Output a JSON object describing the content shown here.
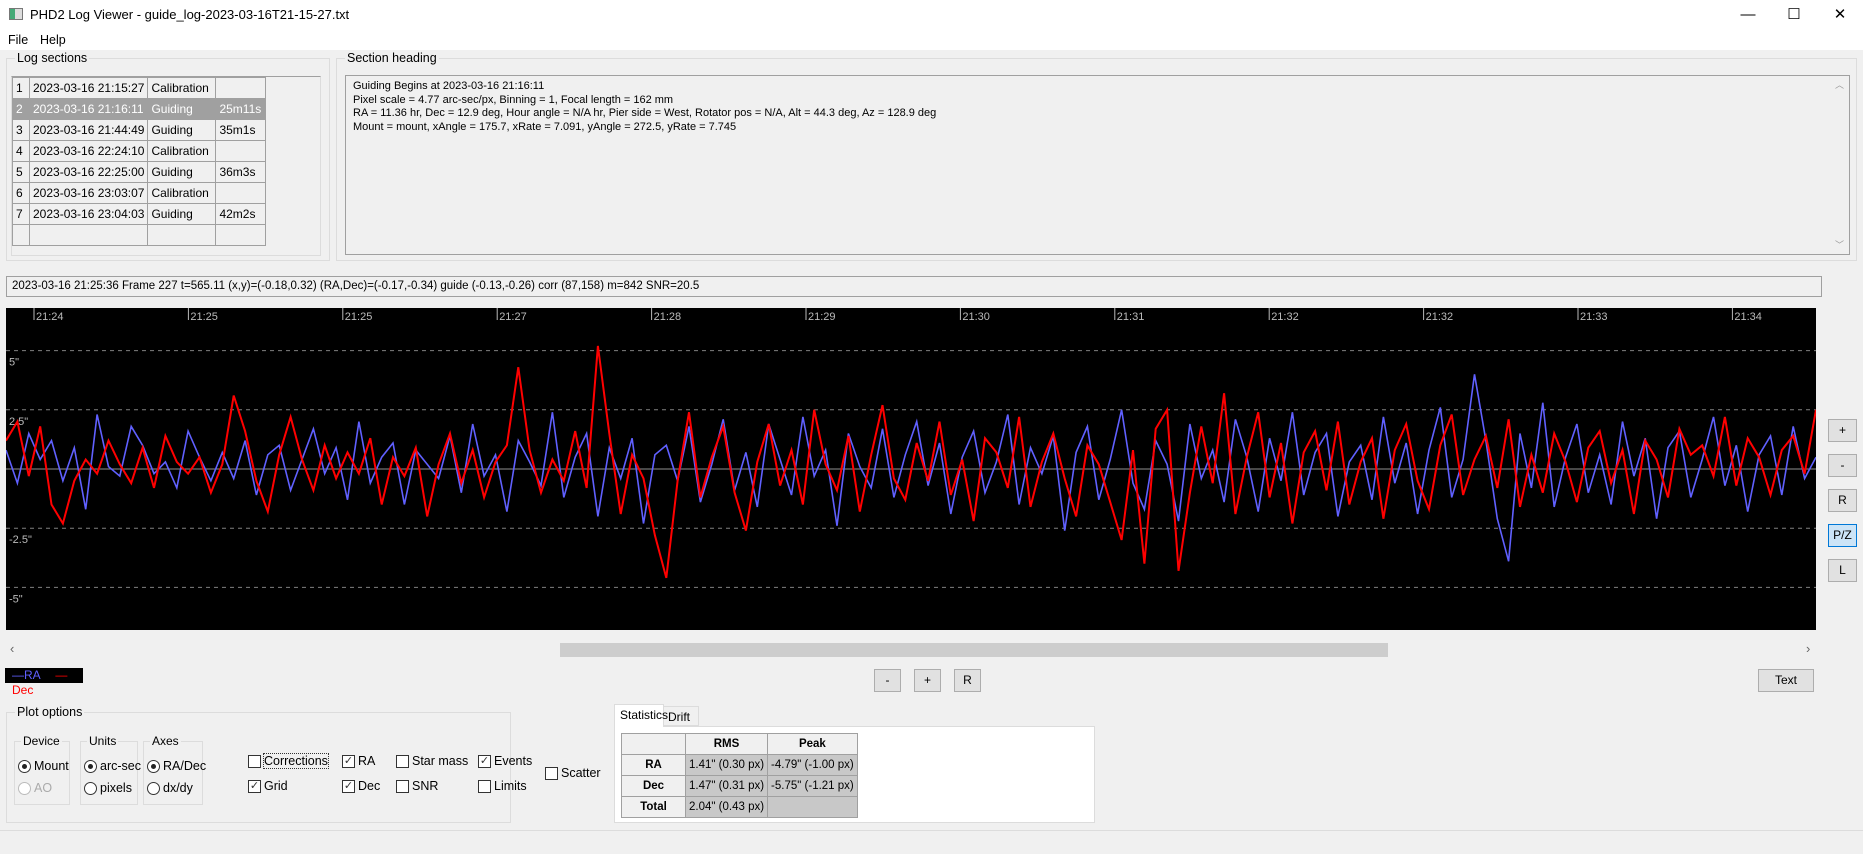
{
  "window": {
    "title": "PHD2 Log Viewer - guide_log-2023-03-16T21-15-27.txt",
    "minimize": "—",
    "maximize": "☐",
    "close": "✕"
  },
  "menu": [
    {
      "label": "File"
    },
    {
      "label": "Help"
    }
  ],
  "log_sections": {
    "label": "Log sections",
    "rows": [
      {
        "n": "1",
        "time": "2023-03-16 21:15:27",
        "type": "Calibration",
        "dur": ""
      },
      {
        "n": "2",
        "time": "2023-03-16 21:16:11",
        "type": "Guiding",
        "dur": "25m11s",
        "selected": true
      },
      {
        "n": "3",
        "time": "2023-03-16 21:44:49",
        "type": "Guiding",
        "dur": "35m1s"
      },
      {
        "n": "4",
        "time": "2023-03-16 22:24:10",
        "type": "Calibration",
        "dur": ""
      },
      {
        "n": "5",
        "time": "2023-03-16 22:25:00",
        "type": "Guiding",
        "dur": "36m3s"
      },
      {
        "n": "6",
        "time": "2023-03-16 23:03:07",
        "type": "Calibration",
        "dur": ""
      },
      {
        "n": "7",
        "time": "2023-03-16 23:04:03",
        "type": "Guiding",
        "dur": "42m2s"
      },
      {
        "n": "",
        "time": "",
        "type": "",
        "dur": ""
      }
    ]
  },
  "section_heading": {
    "label": "Section heading",
    "lines": [
      "Guiding Begins at 2023-03-16 21:16:11",
      "Pixel scale = 4.77 arc-sec/px, Binning = 1, Focal length = 162 mm",
      "RA = 11.36 hr, Dec = 12.9 deg, Hour angle = N/A hr, Pier side = West, Rotator pos = N/A, Alt = 44.3 deg, Az = 128.9 deg",
      "Mount = mount, xAngle = 175.7, xRate = 7.091, yAngle = 272.5, yRate = 7.745"
    ]
  },
  "status_line": "2023-03-16 21:25:36 Frame 227 t=565.11 (x,y)=(-0.18,0.32) (RA,Dec)=(-0.17,-0.34) guide (-0.13,-0.26) corr (87,158) m=842 SNR=20.5",
  "chart_data": {
    "type": "line",
    "grid": true,
    "ylim": [
      -6.8,
      6.8
    ],
    "x_ticks": [
      "21:24",
      "21:25",
      "21:25",
      "21:27",
      "21:28",
      "21:29",
      "21:30",
      "21:31",
      "21:32",
      "21:32",
      "21:33",
      "21:34"
    ],
    "y_ticks": [
      {
        "v": 5,
        "label": "5\""
      },
      {
        "v": 2.5,
        "label": "2.5\""
      },
      {
        "v": 0,
        "label": ""
      },
      {
        "v": -2.5,
        "label": "-2.5\""
      },
      {
        "v": -5,
        "label": "-5\""
      }
    ],
    "series": [
      {
        "name": "RA",
        "color": "#6060ff",
        "values": [
          0.8,
          -0.6,
          1.5,
          0.4,
          1.2,
          -0.5,
          0.9,
          -1.7,
          2.3,
          0.1,
          -0.3,
          1.8,
          1.0,
          -0.2,
          0.3,
          -0.8,
          1.6,
          0.5,
          -0.5,
          0.7,
          -0.4,
          1.2,
          -1.1,
          0.6,
          1.0,
          -0.9,
          0.4,
          1.7,
          -0.2,
          0.9,
          -1.3,
          2.0,
          -0.6,
          0.5,
          1.1,
          -1.5,
          0.8,
          0.2,
          -0.4,
          1.4,
          -1.0,
          1.9,
          -0.3,
          0.6,
          -1.8,
          1.2,
          0.3,
          -0.7,
          2.4,
          -1.2,
          0.5,
          1.5,
          -2.0,
          0.9,
          -0.4,
          1.3,
          -2.3,
          0.6,
          1.0,
          -0.5,
          1.8,
          -1.4,
          0.2,
          2.1,
          -0.9,
          0.7,
          -1.6,
          1.9,
          0.4,
          -1.1,
          2.2,
          -0.3,
          0.8,
          -2.4,
          1.5,
          0.1,
          -0.8,
          1.7,
          -1.2,
          0.6,
          2.0,
          -0.7,
          1.1,
          -1.9,
          0.5,
          1.6,
          -1.0,
          0.3,
          2.3,
          -1.5,
          0.9,
          -0.2,
          1.4,
          -2.6,
          0.7,
          1.8,
          -1.3,
          0.4,
          2.5,
          -0.6,
          -1.7,
          1.2,
          0.2,
          -2.2,
          1.9,
          -0.4,
          0.8,
          -1.4,
          2.1,
          0.5,
          -1.8,
          1.3,
          -0.5,
          2.4,
          -1.1,
          0.7,
          1.5,
          -2.0,
          0.3,
          1.0,
          -1.3,
          2.2,
          -0.6,
          1.1,
          -1.9,
          0.8,
          2.6,
          -1.2,
          0.4,
          4.0,
          1.2,
          -2.1,
          -3.9,
          1.5,
          -0.8,
          2.8,
          -1.6,
          0.5,
          1.9,
          -1.0,
          0.6,
          -1.5,
          2.0,
          -0.3,
          1.3,
          -2.1,
          0.9,
          1.6,
          -1.2,
          0.4,
          2.2,
          -0.7,
          1.0,
          -1.8,
          0.6,
          1.4,
          -1.1,
          1.8,
          -0.4,
          0.5
        ]
      },
      {
        "name": "Dec",
        "color": "#ff0000",
        "values": [
          1.2,
          2.0,
          -0.3,
          1.8,
          -1.5,
          -2.3,
          -0.5,
          0.4,
          -0.2,
          1.2,
          0.2,
          -0.6,
          0.9,
          -0.8,
          1.4,
          0.3,
          -0.2,
          0.5,
          -1.0,
          0.2,
          3.1,
          1.6,
          -0.5,
          -1.8,
          0.6,
          2.2,
          0.4,
          -0.9,
          1.0,
          -0.4,
          0.7,
          -0.2,
          1.3,
          -1.5,
          0.5,
          -0.3,
          0.9,
          -2.0,
          0.2,
          1.5,
          -0.6,
          0.8,
          -1.2,
          0.3,
          1.0,
          4.3,
          0.8,
          -1.0,
          0.4,
          -0.5,
          1.6,
          -0.8,
          5.2,
          1.5,
          -1.9,
          0.6,
          -0.4,
          -2.8,
          -4.6,
          -0.5,
          2.4,
          -1.2,
          0.5,
          1.8,
          -1.0,
          -2.6,
          0.3,
          1.9,
          -0.7,
          0.8,
          -1.5,
          2.5,
          0.2,
          -0.9,
          1.4,
          -1.8,
          0.6,
          2.7,
          -0.4,
          -1.3,
          1.1,
          -0.5,
          2.0,
          -1.1,
          0.4,
          -2.2,
          1.3,
          0.7,
          -0.8,
          2.2,
          -1.6,
          0.3,
          1.5,
          -0.4,
          -2.0,
          1.0,
          0.2,
          -1.4,
          -3.0,
          0.8,
          -4.0,
          1.7,
          2.5,
          -4.3,
          -1.0,
          1.8,
          -0.6,
          3.2,
          -1.9,
          0.5,
          2.4,
          -1.2,
          1.1,
          -2.3,
          0.7,
          1.6,
          -0.9,
          2.0,
          -1.5,
          0.3,
          1.3,
          -2.1,
          0.8,
          1.9,
          -0.5,
          -1.7,
          1.0,
          2.3,
          -1.1,
          0.4,
          1.4,
          -0.8,
          2.1,
          -1.6,
          0.6,
          -1.0,
          1.5,
          0.3,
          -1.4,
          0.9,
          1.6,
          -0.6,
          0.8,
          -1.9,
          1.2,
          0.4,
          -1.2,
          1.7,
          0.6,
          1.0,
          -0.3,
          2.2,
          -0.7,
          1.3,
          0.5,
          -1.1,
          0.8,
          1.4,
          -0.2,
          2.5
        ]
      }
    ]
  },
  "side_buttons": [
    "+",
    "-",
    "R",
    "P/Z",
    "L"
  ],
  "legend": {
    "ra": "—RA",
    "dec": "—Dec"
  },
  "zoom_buttons": [
    "-",
    "+",
    "R"
  ],
  "text_button": "Text",
  "plot_options": {
    "label": "Plot options",
    "device": {
      "label": "Device",
      "options": [
        {
          "label": "Mount",
          "on": true
        },
        {
          "label": "AO",
          "disabled": true
        }
      ]
    },
    "units": {
      "label": "Units",
      "options": [
        {
          "label": "arc-sec",
          "on": true
        },
        {
          "label": "pixels"
        }
      ]
    },
    "axes": {
      "label": "Axes",
      "options": [
        {
          "label": "RA/Dec",
          "on": true
        },
        {
          "label": "dx/dy"
        }
      ]
    },
    "checks": {
      "corrections": {
        "label": "Corrections",
        "on": false
      },
      "grid": {
        "label": "Grid",
        "on": true
      },
      "ra": {
        "label": "RA",
        "on": true
      },
      "dec": {
        "label": "Dec",
        "on": true
      },
      "star_mass": {
        "label": "Star mass",
        "on": false
      },
      "snr": {
        "label": "SNR",
        "on": false
      },
      "events": {
        "label": "Events",
        "on": true
      },
      "limits": {
        "label": "Limits",
        "on": false
      },
      "scatter": {
        "label": "Scatter",
        "on": false
      }
    }
  },
  "tabs": [
    {
      "label": "Statistics",
      "active": true
    },
    {
      "label": "Drift"
    }
  ],
  "stats": {
    "headers": [
      "",
      "RMS",
      "Peak"
    ],
    "rows": [
      [
        "RA",
        "1.41\" (0.30 px)",
        "-4.79\" (-1.00 px)"
      ],
      [
        "Dec",
        "1.47\" (0.31 px)",
        "-5.75\" (-1.21 px)"
      ],
      [
        "Total",
        "2.04\" (0.43 px)",
        ""
      ]
    ]
  }
}
